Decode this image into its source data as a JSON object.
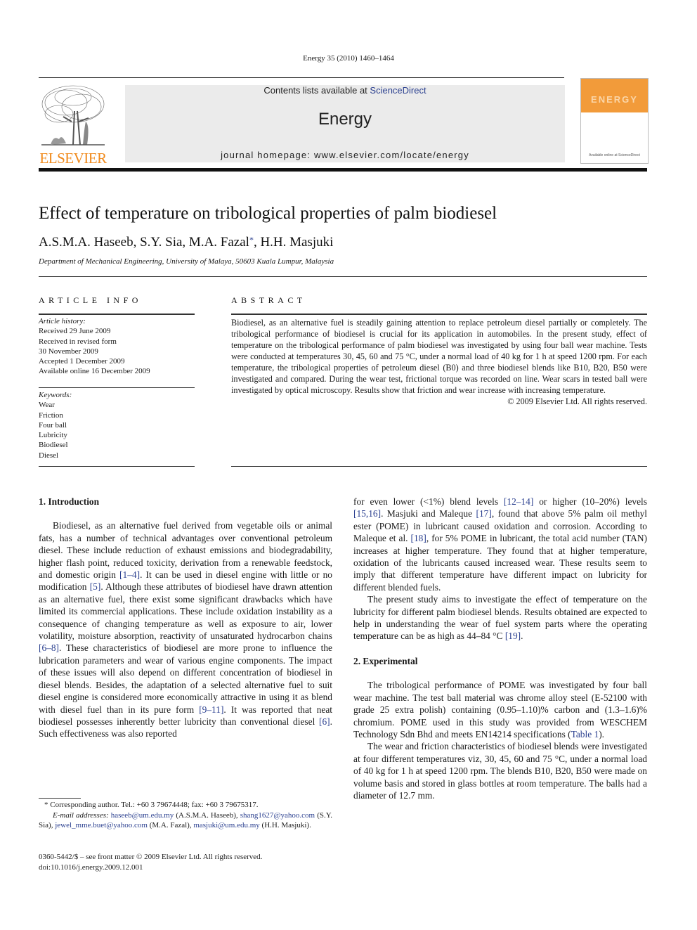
{
  "header": {
    "citation": "Energy 35 (2010) 1460–1464",
    "contents_prefix": "Contents lists available at ",
    "contents_link": "ScienceDirect",
    "journal_name": "Energy",
    "homepage": "journal homepage: www.elsevier.com/locate/energy",
    "publisher_logo_text": "ELSEVIER",
    "cover_title": "ENERGY",
    "cover_footer": "Available online at ScienceDirect",
    "colors": {
      "publisher_orange": "#f08a1c",
      "cover_orange": "#f29b3a",
      "link_blue": "#2a3f8f",
      "band_gray": "#ebebeb"
    }
  },
  "article": {
    "title": "Effect of temperature on tribological properties of palm biodiesel",
    "authors_before": "A.S.M.A. Haseeb, S.Y. Sia, M.A. Fazal",
    "authors_star": "*",
    "authors_after": ", H.H. Masjuki",
    "affiliation": "Department of Mechanical Engineering, University of Malaya, 50603 Kuala Lumpur, Malaysia"
  },
  "article_info": {
    "heading": "ARTICLE INFO",
    "history_label": "Article history:",
    "history": [
      "Received 29 June 2009",
      "Received in revised form",
      "30 November 2009",
      "Accepted 1 December 2009",
      "Available online 16 December 2009"
    ],
    "keywords_label": "Keywords:",
    "keywords": [
      "Wear",
      "Friction",
      "Four ball",
      "Lubricity",
      "Biodiesel",
      "Diesel"
    ]
  },
  "abstract": {
    "heading": "ABSTRACT",
    "text": "Biodiesel, as an alternative fuel is steadily gaining attention to replace petroleum diesel partially or completely. The tribological performance of biodiesel is crucial for its application in automobiles. In the present study, effect of temperature on the tribological performance of palm biodiesel was investigated by using four ball wear machine. Tests were conducted at temperatures 30, 45, 60 and 75 °C, under a normal load of 40 kg for 1 h at speed 1200 rpm. For each temperature, the tribological properties of petroleum diesel (B0) and three biodiesel blends like B10, B20, B50 were investigated and compared. During the wear test, frictional torque was recorded on line. Wear scars in tested ball were investigated by optical microscopy. Results show that friction and wear increase with increasing temperature.",
    "copyright": "© 2009 Elsevier Ltd. All rights reserved."
  },
  "body": {
    "intro_heading": "1.  Introduction",
    "intro_p1": [
      "Biodiesel, as an alternative fuel derived from vegetable oils or animal fats, has a number of technical advantages over conventional petroleum diesel. These include reduction of exhaust emissions and biodegradability, higher flash point, reduced toxicity, derivation from a renewable feedstock, and domestic origin ",
      "[1–4]",
      ". It can be used in diesel engine with little or no modification ",
      "[5]",
      ". Although these attributes of biodiesel have drawn attention as an alternative fuel, there exist some significant drawbacks which have limited its commercial applications. These include oxidation instability as a consequence of changing temperature as well as exposure to air, lower volatility, moisture absorption, reactivity of unsaturated hydrocarbon chains ",
      "[6–8]",
      ". These characteristics of biodiesel are more prone to influence the lubrication parameters and wear of various engine components. The impact of these issues will also depend on different concentration of biodiesel in diesel blends. Besides, the adaptation of a selected alternative fuel to suit diesel engine is considered more economically attractive in using it as blend with diesel fuel than in its pure form ",
      "[9–11]",
      ". It was reported that neat biodiesel possesses inherently better lubricity than conventional diesel ",
      "[6]",
      ". Such effectiveness was also reported"
    ],
    "intro_p1_cont": [
      "for even lower (<1%) blend levels ",
      "[12–14]",
      " or higher (10–20%) levels ",
      "[15,16]",
      ". Masjuki and Maleque ",
      "[17]",
      ", found that above 5% palm oil methyl ester (POME) in lubricant caused oxidation and corrosion. According to Maleque et al. ",
      "[18]",
      ", for 5% POME in lubricant, the total acid number (TAN) increases at higher temperature. They found that at higher temperature, oxidation of the lubricants caused increased wear. These results seem to imply that different temperature have different impact on lubricity for different blended fuels."
    ],
    "intro_p2": [
      "The present study aims to investigate the effect of temperature on the lubricity for different palm biodiesel blends. Results obtained are expected to help in understanding the wear of fuel system parts where the operating temperature can be as high as 44–84 °C ",
      "[19]",
      "."
    ],
    "exp_heading": "2.  Experimental",
    "exp_p1": [
      "The tribological performance of POME was investigated by four ball wear machine. The test ball material was chrome alloy steel (E-52100 with grade 25 extra polish) containing (0.95–1.10)% carbon and (1.3–1.6)% chromium. POME used in this study was provided from WESCHEM Technology Sdn Bhd and meets EN14214 specifications (",
      "Table 1",
      ")."
    ],
    "exp_p2": "The wear and friction characteristics of biodiesel blends were investigated at four different temperatures viz, 30, 45, 60 and 75 °C, under a normal load of 40 kg for 1 h at speed 1200 rpm. The blends B10, B20, B50 were made on volume basis and stored in glass bottles at room temperature. The balls had a diameter of 12.7 mm."
  },
  "footnote": {
    "corresponding": "* Corresponding author. Tel.: +60 3 79674448; fax: +60 3 79675317.",
    "email_label": "E-mail addresses:",
    "emails": [
      {
        "address": "haseeb@um.edu.my",
        "name": " (A.S.M.A. Haseeb), "
      },
      {
        "address": "shang1627@yahoo.com",
        "name": " (S.Y. Sia), "
      },
      {
        "address": "jewel_mme.buet@yahoo.com",
        "name": " (M.A. Fazal), "
      },
      {
        "address": "masjuki@um.edu.my",
        "name": " (H.H. Masjuki)."
      }
    ],
    "front_matter": "0360-5442/$ – see front matter © 2009 Elsevier Ltd. All rights reserved.",
    "doi": "doi:10.1016/j.energy.2009.12.001"
  }
}
